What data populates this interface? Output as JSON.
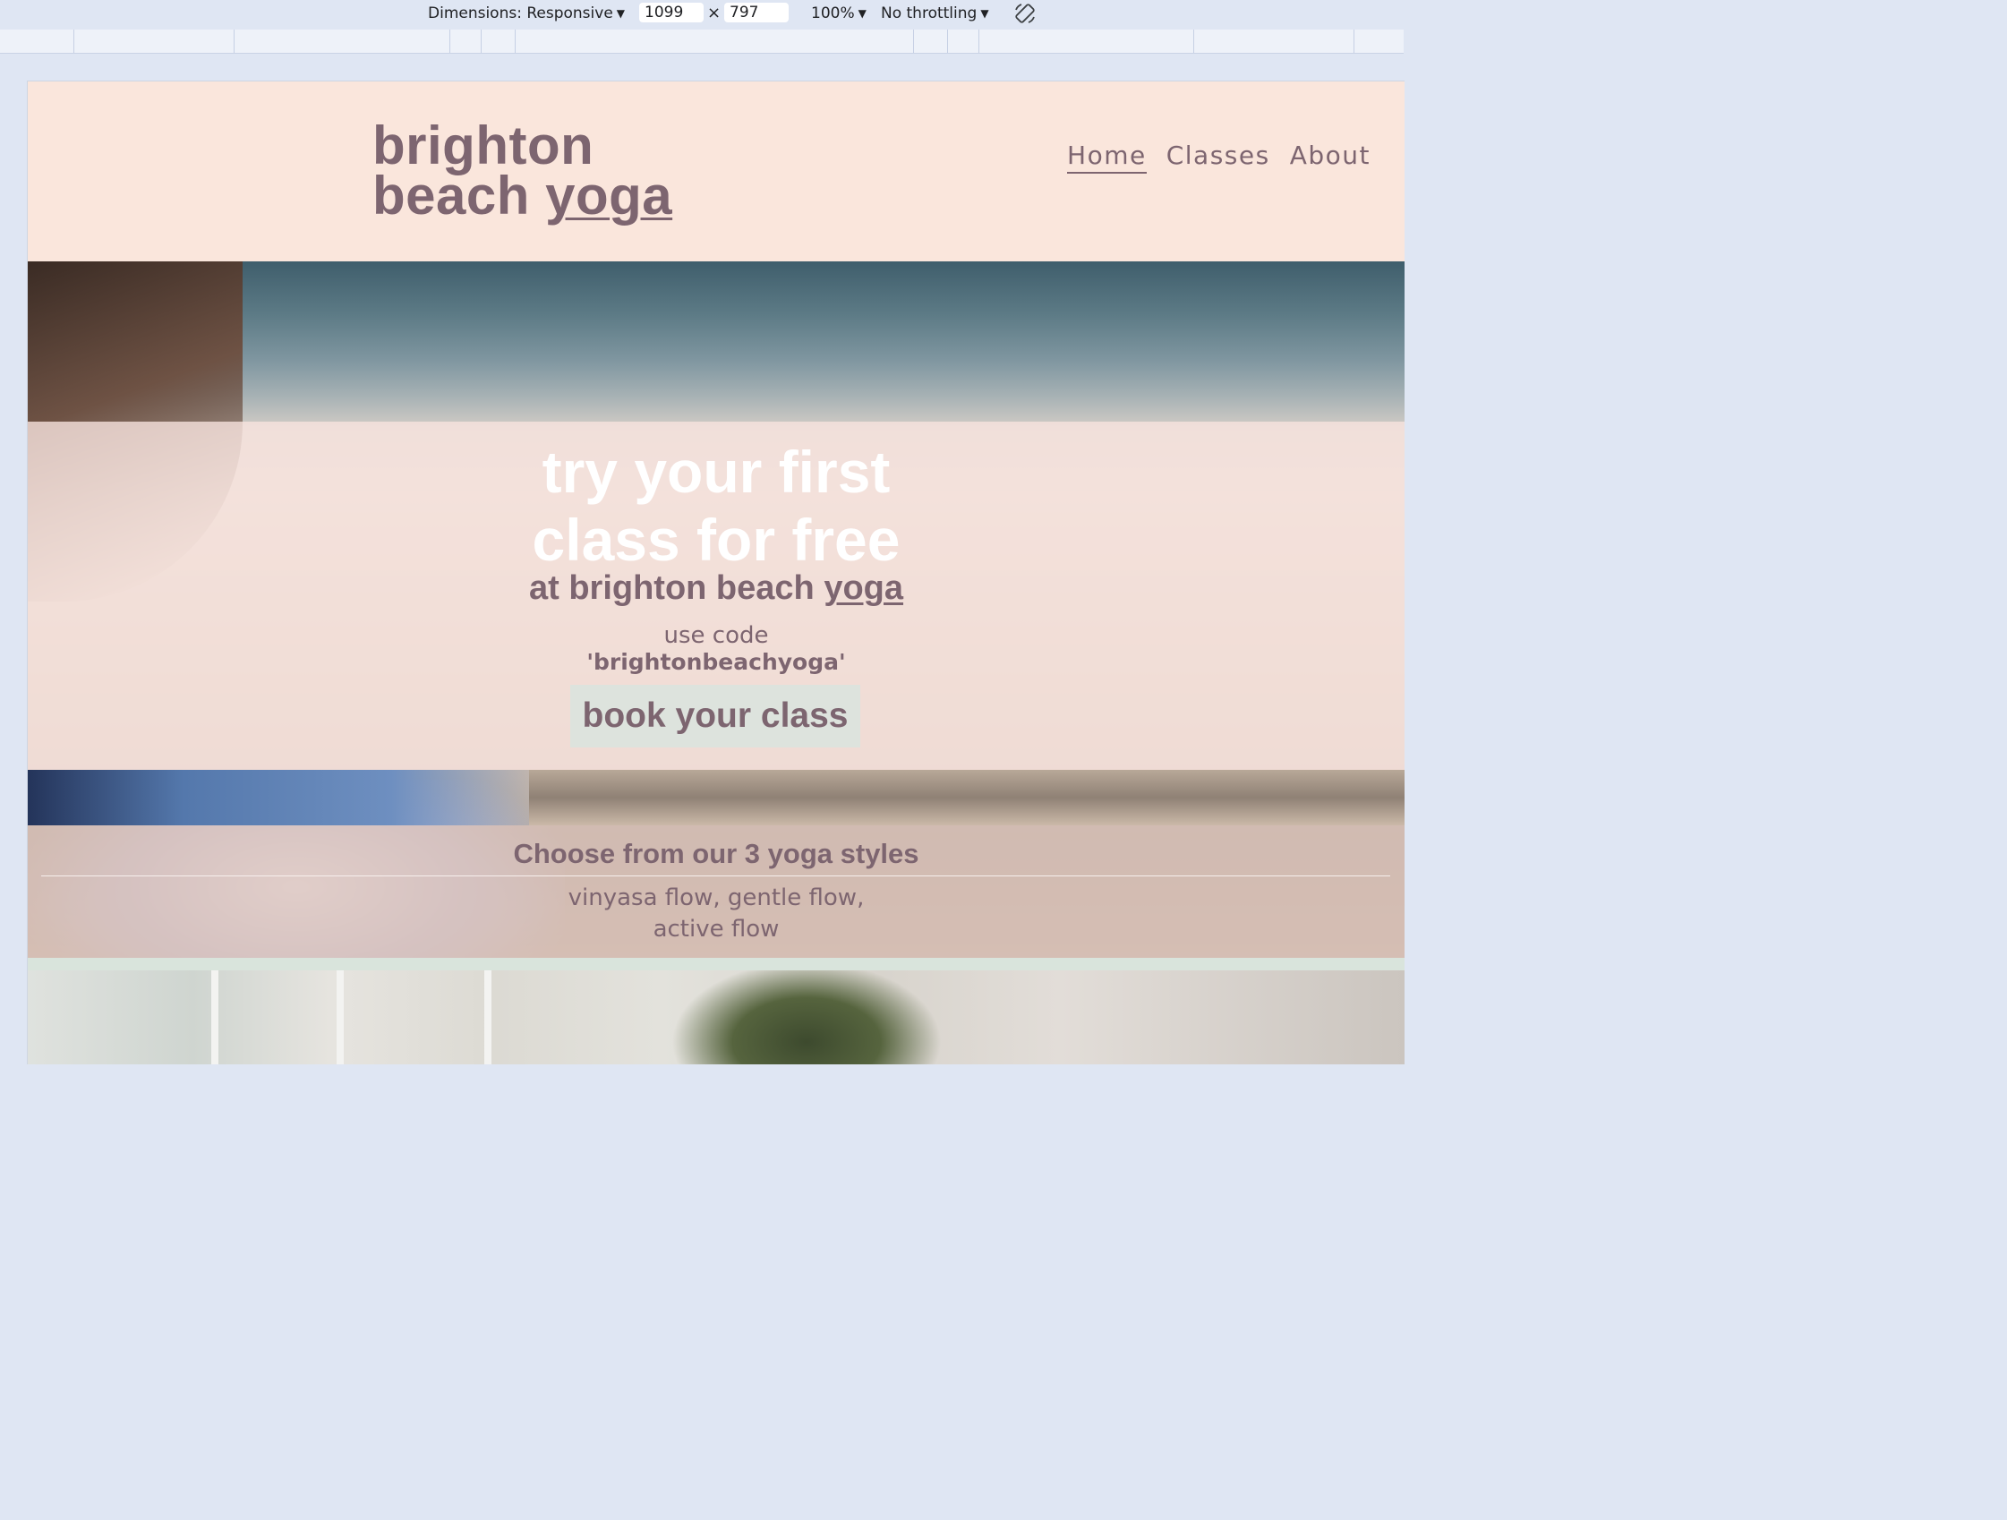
{
  "devtools": {
    "dimensions_label": "Dimensions: Responsive",
    "width": "1099",
    "times": "×",
    "height": "797",
    "zoom": "100%",
    "throttling": "No throttling",
    "icons": [
      "caret-down-icon",
      "rotate-icon"
    ]
  },
  "site": {
    "logo_line1": "brighton",
    "logo_line2_a": "beach ",
    "logo_line2_b": "yoga",
    "nav": [
      {
        "label": "Home",
        "active": true
      },
      {
        "label": "Classes",
        "active": false
      },
      {
        "label": "About",
        "active": false
      }
    ]
  },
  "hero": {
    "title_line1": "try your first",
    "title_line2": "class for free",
    "subtitle_a": "at brighton beach ",
    "subtitle_b": "yoga",
    "promo_line": "use code",
    "promo_code": "'brightonbeachyoga'",
    "cta_label": "book your class"
  },
  "styles_section": {
    "heading": "Choose from our 3 yoga styles",
    "list_line1": "vinyasa flow, gentle flow,",
    "list_line2": "active flow"
  },
  "colors": {
    "header_bg": "#fae6dc",
    "brand_text": "#7d6570",
    "cta_bg": "#dde3dd",
    "mint_band": "#d9e4dc"
  }
}
